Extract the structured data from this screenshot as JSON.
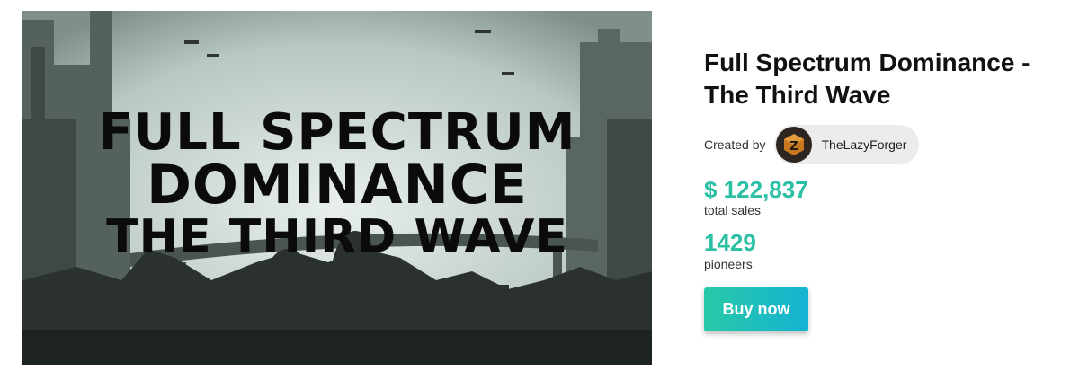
{
  "hero": {
    "line1": "FULL SPECTRUM",
    "line2": "DOMINANCE",
    "line3": "THE THIRD WAVE"
  },
  "product": {
    "title_line1": "Full Spectrum Dominance -",
    "title_line2": "The Third Wave",
    "created_by_label": "Created by",
    "creator_name": "TheLazyForger",
    "avatar_letter": "Z"
  },
  "stats": {
    "sales_value": "$ 122,837",
    "sales_label": "total sales",
    "pioneers_value": "1429",
    "pioneers_label": "pioneers"
  },
  "actions": {
    "buy_label": "Buy now"
  },
  "colors": {
    "accent": "#2bbfa4",
    "button_start": "#27c9a6",
    "button_end": "#16b3d4"
  }
}
